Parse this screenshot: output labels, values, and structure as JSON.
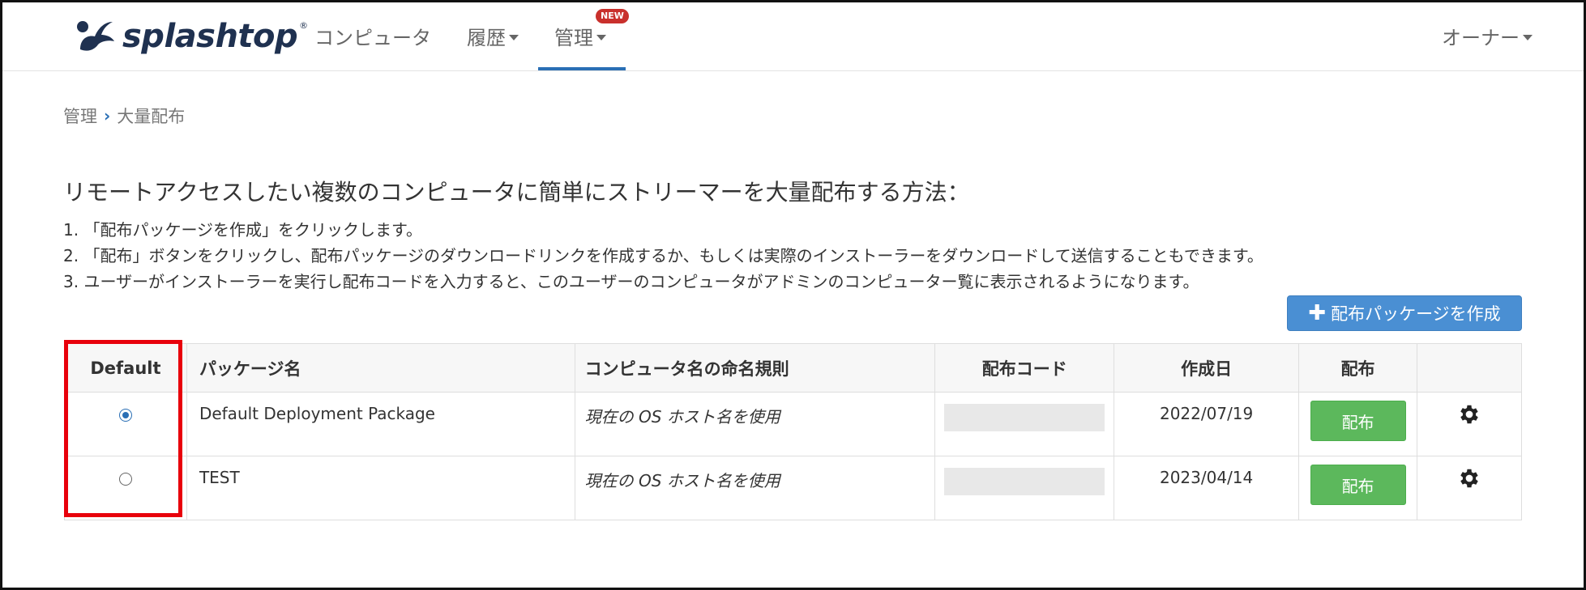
{
  "brand": {
    "name": "splashtop",
    "reg": "®",
    "colors": {
      "logo": "#1f3150",
      "accent": "#2a6fb5"
    }
  },
  "nav": {
    "computers": "コンピュータ",
    "history": "履歴",
    "manage": "管理",
    "new_badge": "NEW",
    "owner": "オーナー"
  },
  "breadcrumb": {
    "parent": "管理",
    "current": "大量配布"
  },
  "headline": "リモートアクセスしたい複数のコンピュータに簡単にストリーマーを大量配布する方法：",
  "steps": [
    "1. 「配布パッケージを作成」をクリックします。",
    "2. 「配布」ボタンをクリックし、配布パッケージのダウンロードリンクを作成するか、もしくは実際のインストーラーをダウンロードして送信することもできます。",
    "3. ユーザーがインストーラーを実行し配布コードを入力すると、このユーザーのコンピュータがアドミンのコンピューター覧に表示されるようになります。"
  ],
  "create_button": "配布パッケージを作成",
  "table": {
    "headers": {
      "default": "Default",
      "package": "パッケージ名",
      "naming": "コンピュータ名の命名規則",
      "code": "配布コード",
      "created": "作成日",
      "distribute": "配布"
    },
    "rows": [
      {
        "default": true,
        "package": "Default Deployment Package",
        "naming": "現在の OS ホスト名を使用",
        "created": "2022/07/19",
        "action": "配布"
      },
      {
        "default": false,
        "package": "TEST",
        "naming": "現在の OS ホスト名を使用",
        "created": "2023/04/14",
        "action": "配布"
      }
    ]
  },
  "icons": {
    "gear": "gear-icon",
    "plus": "plus-icon",
    "chevron": "chevron-right-icon"
  }
}
